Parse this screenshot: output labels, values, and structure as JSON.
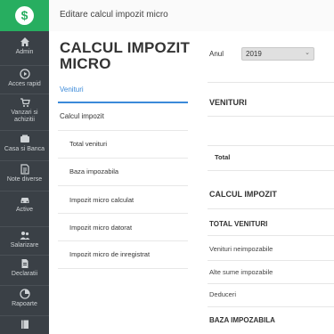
{
  "logo": {
    "symbol": "$"
  },
  "sidebar": {
    "items": [
      {
        "label": "Admin",
        "icon": "home-icon"
      },
      {
        "label": "Acces rapid",
        "icon": "play-circle-icon"
      },
      {
        "label": "Vanzari si achizitii",
        "icon": "cart-icon"
      },
      {
        "label": "Casa si Banca",
        "icon": "bank-icon"
      },
      {
        "label": "Note diverse",
        "icon": "notes-icon"
      },
      {
        "label": "Active",
        "icon": "car-icon"
      },
      {
        "label": "Salarizare",
        "icon": "people-icon"
      },
      {
        "label": "Declaratii",
        "icon": "document-icon"
      },
      {
        "label": "Rapoarte",
        "icon": "chart-icon"
      },
      {
        "label": "",
        "icon": "book-icon"
      }
    ]
  },
  "topbar": {
    "title": "Editare calcul impozit micro"
  },
  "left": {
    "page_title": "CALCUL IMPOZIT MICRO",
    "tab": "Venituri",
    "section": "Calcul impozit",
    "menu": [
      "Total venituri",
      "Baza impozabila",
      "Impozit micro calculat",
      "Impozit micro datorat",
      "Impozit micro de inregistrat"
    ]
  },
  "main": {
    "year_label": "Anul",
    "year_value": "2019",
    "venituri_heading": "VENITURI",
    "total_label": "Total",
    "calcul_heading": "CALCUL IMPOZIT",
    "total_venituri": "TOTAL VENITURI",
    "venituri_neimpozabile": "Venituri neimpozabile",
    "alte_sume": "Alte sume impozabile",
    "deduceri": "Deduceri",
    "baza_impozabila": "BAZA IMPOZABILA"
  },
  "colors": {
    "sidebar": "#3a4046",
    "brand": "#27ae60",
    "accent": "#3b8ad9"
  }
}
